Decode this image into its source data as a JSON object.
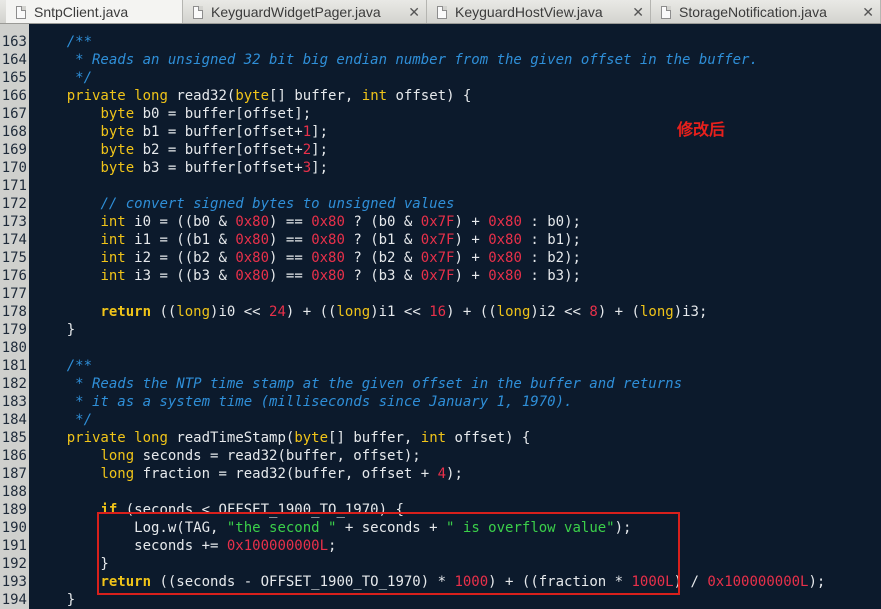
{
  "tabs": [
    {
      "label": "SntpClient.java",
      "active": true
    },
    {
      "label": "KeyguardWidgetPager.java",
      "active": false
    },
    {
      "label": "KeyguardHostView.java",
      "active": false
    },
    {
      "label": "StorageNotification.java",
      "active": false
    }
  ],
  "annotation": "修改后",
  "colors": {
    "background": "#0c1a2c",
    "comment": "#2f8fd8",
    "keyword": "#f0c419",
    "number": "#e8304a",
    "string": "#3bd04a",
    "highlight_box": "#d8201c"
  },
  "code_lines": [
    {
      "n": "163",
      "tokens": [
        [
          "p",
          "    "
        ],
        [
          "c",
          "/**"
        ]
      ]
    },
    {
      "n": "164",
      "tokens": [
        [
          "c",
          "     * Reads an unsigned 32 bit big endian number from the given offset in the buffer."
        ]
      ]
    },
    {
      "n": "165",
      "tokens": [
        [
          "c",
          "     */"
        ]
      ]
    },
    {
      "n": "166",
      "tokens": [
        [
          "p",
          "    "
        ],
        [
          "t",
          "private"
        ],
        [
          "p",
          " "
        ],
        [
          "t",
          "long"
        ],
        [
          "p",
          " read32("
        ],
        [
          "t",
          "byte"
        ],
        [
          "p",
          "[] buffer, "
        ],
        [
          "t",
          "int"
        ],
        [
          "p",
          " offset) {"
        ]
      ]
    },
    {
      "n": "167",
      "tokens": [
        [
          "p",
          "        "
        ],
        [
          "t",
          "byte"
        ],
        [
          "p",
          " b0 = buffer[offset];"
        ]
      ]
    },
    {
      "n": "168",
      "tokens": [
        [
          "p",
          "        "
        ],
        [
          "t",
          "byte"
        ],
        [
          "p",
          " b1 = buffer[offset+"
        ],
        [
          "n",
          "1"
        ],
        [
          "p",
          "];"
        ]
      ]
    },
    {
      "n": "169",
      "tokens": [
        [
          "p",
          "        "
        ],
        [
          "t",
          "byte"
        ],
        [
          "p",
          " b2 = buffer[offset+"
        ],
        [
          "n",
          "2"
        ],
        [
          "p",
          "];"
        ]
      ]
    },
    {
      "n": "170",
      "tokens": [
        [
          "p",
          "        "
        ],
        [
          "t",
          "byte"
        ],
        [
          "p",
          " b3 = buffer[offset+"
        ],
        [
          "n",
          "3"
        ],
        [
          "p",
          "];"
        ]
      ]
    },
    {
      "n": "171",
      "tokens": []
    },
    {
      "n": "172",
      "tokens": [
        [
          "p",
          "        "
        ],
        [
          "c",
          "// convert signed bytes to unsigned values"
        ]
      ]
    },
    {
      "n": "173",
      "tokens": [
        [
          "p",
          "        "
        ],
        [
          "t",
          "int"
        ],
        [
          "p",
          " i0 = ((b0 & "
        ],
        [
          "n",
          "0x80"
        ],
        [
          "p",
          ") == "
        ],
        [
          "n",
          "0x80"
        ],
        [
          "p",
          " ? (b0 & "
        ],
        [
          "n",
          "0x7F"
        ],
        [
          "p",
          ") + "
        ],
        [
          "n",
          "0x80"
        ],
        [
          "p",
          " : b0);"
        ]
      ]
    },
    {
      "n": "174",
      "tokens": [
        [
          "p",
          "        "
        ],
        [
          "t",
          "int"
        ],
        [
          "p",
          " i1 = ((b1 & "
        ],
        [
          "n",
          "0x80"
        ],
        [
          "p",
          ") == "
        ],
        [
          "n",
          "0x80"
        ],
        [
          "p",
          " ? (b1 & "
        ],
        [
          "n",
          "0x7F"
        ],
        [
          "p",
          ") + "
        ],
        [
          "n",
          "0x80"
        ],
        [
          "p",
          " : b1);"
        ]
      ]
    },
    {
      "n": "175",
      "tokens": [
        [
          "p",
          "        "
        ],
        [
          "t",
          "int"
        ],
        [
          "p",
          " i2 = ((b2 & "
        ],
        [
          "n",
          "0x80"
        ],
        [
          "p",
          ") == "
        ],
        [
          "n",
          "0x80"
        ],
        [
          "p",
          " ? (b2 & "
        ],
        [
          "n",
          "0x7F"
        ],
        [
          "p",
          ") + "
        ],
        [
          "n",
          "0x80"
        ],
        [
          "p",
          " : b2);"
        ]
      ]
    },
    {
      "n": "176",
      "tokens": [
        [
          "p",
          "        "
        ],
        [
          "t",
          "int"
        ],
        [
          "p",
          " i3 = ((b3 & "
        ],
        [
          "n",
          "0x80"
        ],
        [
          "p",
          ") == "
        ],
        [
          "n",
          "0x80"
        ],
        [
          "p",
          " ? (b3 & "
        ],
        [
          "n",
          "0x7F"
        ],
        [
          "p",
          ") + "
        ],
        [
          "n",
          "0x80"
        ],
        [
          "p",
          " : b3);"
        ]
      ]
    },
    {
      "n": "177",
      "tokens": []
    },
    {
      "n": "178",
      "tokens": [
        [
          "p",
          "        "
        ],
        [
          "k",
          "return"
        ],
        [
          "p",
          " (("
        ],
        [
          "t",
          "long"
        ],
        [
          "p",
          ")i0 << "
        ],
        [
          "n",
          "24"
        ],
        [
          "p",
          ") + (("
        ],
        [
          "t",
          "long"
        ],
        [
          "p",
          ")i1 << "
        ],
        [
          "n",
          "16"
        ],
        [
          "p",
          ") + (("
        ],
        [
          "t",
          "long"
        ],
        [
          "p",
          ")i2 << "
        ],
        [
          "n",
          "8"
        ],
        [
          "p",
          ") + ("
        ],
        [
          "t",
          "long"
        ],
        [
          "p",
          ")i3;"
        ]
      ]
    },
    {
      "n": "179",
      "tokens": [
        [
          "p",
          "    }"
        ]
      ]
    },
    {
      "n": "180",
      "tokens": []
    },
    {
      "n": "181",
      "tokens": [
        [
          "p",
          "    "
        ],
        [
          "c",
          "/**"
        ]
      ]
    },
    {
      "n": "182",
      "tokens": [
        [
          "c",
          "     * Reads the NTP time stamp at the given offset in the buffer and returns"
        ]
      ]
    },
    {
      "n": "183",
      "tokens": [
        [
          "c",
          "     * it as a system time (milliseconds since January 1, 1970)."
        ]
      ]
    },
    {
      "n": "184",
      "tokens": [
        [
          "c",
          "     */"
        ]
      ]
    },
    {
      "n": "185",
      "tokens": [
        [
          "p",
          "    "
        ],
        [
          "t",
          "private"
        ],
        [
          "p",
          " "
        ],
        [
          "t",
          "long"
        ],
        [
          "p",
          " readTimeStamp("
        ],
        [
          "t",
          "byte"
        ],
        [
          "p",
          "[] buffer, "
        ],
        [
          "t",
          "int"
        ],
        [
          "p",
          " offset) {"
        ]
      ]
    },
    {
      "n": "186",
      "tokens": [
        [
          "p",
          "        "
        ],
        [
          "t",
          "long"
        ],
        [
          "p",
          " seconds = read32(buffer, offset);"
        ]
      ]
    },
    {
      "n": "187",
      "tokens": [
        [
          "p",
          "        "
        ],
        [
          "t",
          "long"
        ],
        [
          "p",
          " fraction = read32(buffer, offset + "
        ],
        [
          "n",
          "4"
        ],
        [
          "p",
          ");"
        ]
      ]
    },
    {
      "n": "188",
      "tokens": []
    },
    {
      "n": "189",
      "tokens": [
        [
          "p",
          "        "
        ],
        [
          "k",
          "if"
        ],
        [
          "p",
          " (seconds < OFFSET_1900_TO_1970) {"
        ]
      ]
    },
    {
      "n": "190",
      "tokens": [
        [
          "p",
          "            Log.w(TAG, "
        ],
        [
          "s",
          "\"the second \""
        ],
        [
          "p",
          " + seconds + "
        ],
        [
          "s",
          "\" is overflow value\""
        ],
        [
          "p",
          ");"
        ]
      ]
    },
    {
      "n": "191",
      "tokens": [
        [
          "p",
          "            seconds += "
        ],
        [
          "n",
          "0x100000000L"
        ],
        [
          "p",
          ";"
        ]
      ]
    },
    {
      "n": "192",
      "tokens": [
        [
          "p",
          "        }"
        ]
      ]
    },
    {
      "n": "193",
      "tokens": [
        [
          "p",
          "        "
        ],
        [
          "k",
          "return"
        ],
        [
          "p",
          " ((seconds - OFFSET_1900_TO_1970) * "
        ],
        [
          "n",
          "1000"
        ],
        [
          "p",
          ") + ((fraction * "
        ],
        [
          "n",
          "1000L"
        ],
        [
          "p",
          ") / "
        ],
        [
          "n",
          "0x100000000L"
        ],
        [
          "p",
          ");"
        ]
      ]
    },
    {
      "n": "194",
      "tokens": [
        [
          "p",
          "    }"
        ]
      ]
    }
  ]
}
